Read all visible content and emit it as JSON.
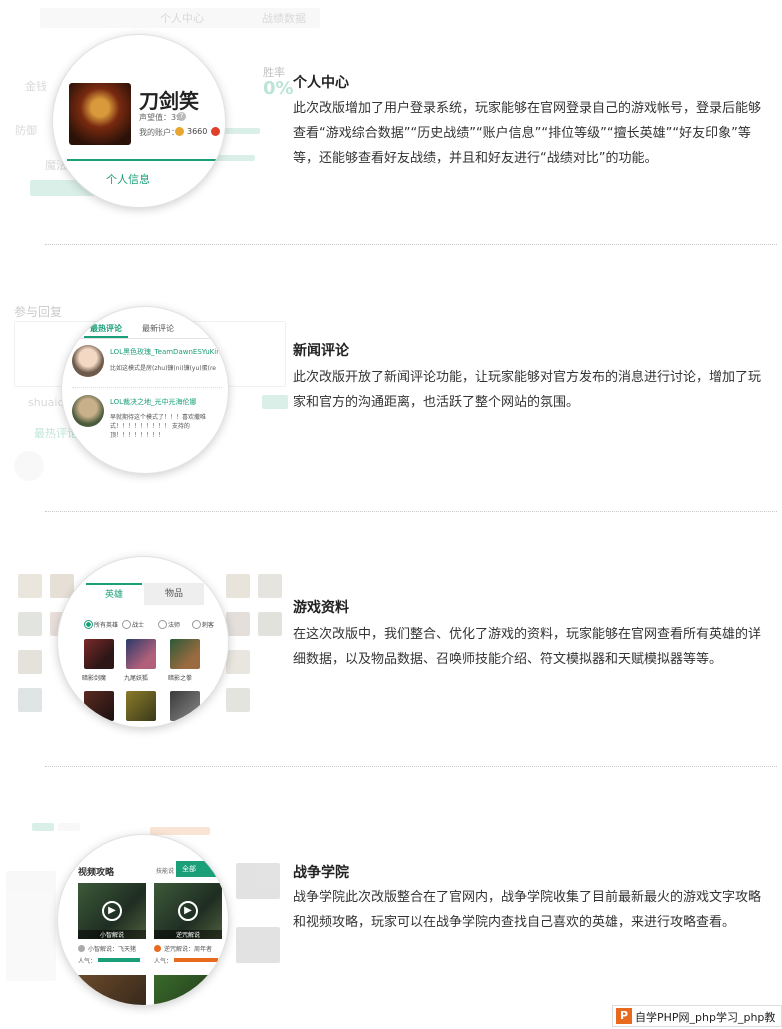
{
  "sections": [
    {
      "title": "个人中心",
      "desc": "此次改版增加了用户登录系统，玩家能够在官网登录自己的游戏帐号，登录后能够查看“游戏综合数据”“历史战绩”“账户信息”“排位等级”“擅长英雄”“好友印象”等等，还能够查看好友战绩，并且和好友进行“战绩对比”的功能。",
      "lens": {
        "name": "刀剑笑",
        "reputation": "声望值：39",
        "account_label": "我的账户：",
        "account_value": "3660",
        "tab": "个人信息"
      },
      "bg": {
        "win_label": "胜率",
        "win_value": "0%",
        "tabs": [
          "个人中心",
          "战绩数据"
        ],
        "stats": [
          "金钱",
          "防御",
          "魔法"
        ]
      }
    },
    {
      "title": "新闻评论",
      "desc": "此次改版开放了新闻评论功能，让玩家能够对官方发布的消息进行讨论，增加了玩家和官方的沟通距离，也活跃了整个网站的氛围。",
      "lens": {
        "tabs": [
          "最热评论",
          "最新评论"
        ],
        "comments": [
          {
            "user": "LOL黑色玫瑰_TeamDawnESYuKin",
            "text": "比如这模式是房(zhu)镰(ni)镰(yu)蛋(re"
          },
          {
            "user": "LOL裁决之地_光中光海伦娜",
            "text": "早就期待这个模式了！！！喜欢撒唯式！！！！！！！！！ 支持的顶！！！！！！！！"
          }
        ]
      },
      "bg": {
        "heading": "参与回复",
        "user": "shuaiqu",
        "tab": "最热评论"
      }
    },
    {
      "title": "游戏资料",
      "desc": "在这次改版中，我们整合、优化了游戏的资料，玩家能够在官网查看所有英雄的详细数据，以及物品数据、召唤师技能介绍、符文模拟器和天赋模拟器等等。",
      "lens": {
        "tabs": [
          "英雄",
          "物品"
        ],
        "filters": [
          "所有英雄",
          "战士",
          "法师",
          "刺客"
        ],
        "heroes": [
          "暗影剑魔",
          "九尾妖狐",
          "暗影之拳"
        ]
      }
    },
    {
      "title": "战争学院",
      "desc": "战争学院此次改版整合在了官网内，战争学院收集了目前最新最火的游戏文字攻略和视频攻略，玩家可以在战争学院内查找自己喜欢的英雄，来进行攻略查看。",
      "lens": {
        "heading": "视频攻略",
        "filter_label": "技能说",
        "filter_value": "全部",
        "videos": [
          {
            "title": "小智解说",
            "author": "小智解说：飞天猪"
          },
          {
            "title": "逆咒解说",
            "author": "逆咒解说：周年者"
          }
        ],
        "popularity_label": "人气："
      }
    }
  ],
  "watermark": "自学PHP网_php学习_php教",
  "colors": {
    "accent": "#1a9f78",
    "orange": "#e86a1e"
  }
}
